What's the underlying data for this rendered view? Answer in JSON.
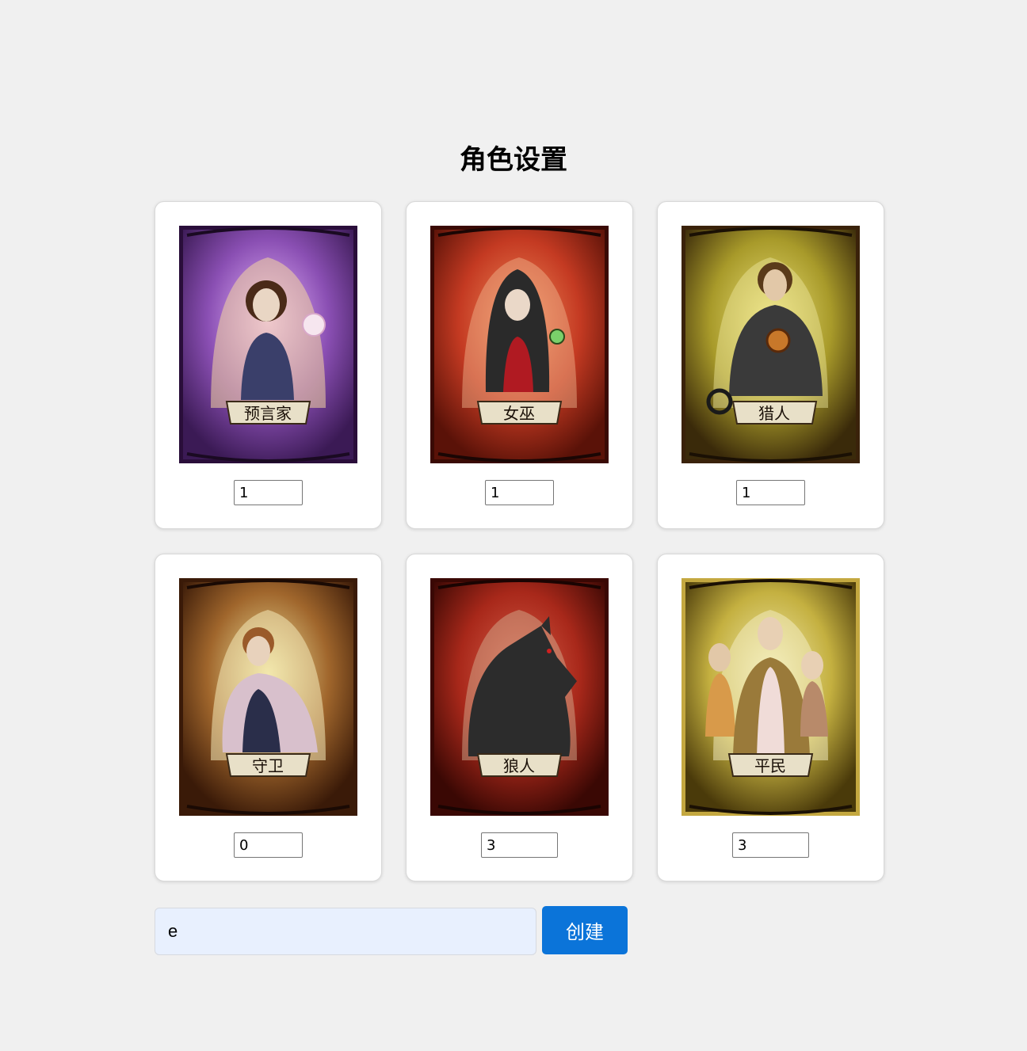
{
  "page": {
    "title": "角色设置"
  },
  "roles": [
    {
      "name": "预言家",
      "count": "1",
      "theme": "#8a4fb3",
      "accent": "#c9a2e0",
      "icon": "seer-portrait"
    },
    {
      "name": "女巫",
      "count": "1",
      "theme": "#c43a22",
      "accent": "#e8734a",
      "icon": "witch-portrait"
    },
    {
      "name": "猎人",
      "count": "1",
      "theme": "#a89a2a",
      "accent": "#d8cc4e",
      "icon": "hunter-portrait"
    },
    {
      "name": "守卫",
      "count": "0",
      "theme": "#a0662c",
      "accent": "#d4a860",
      "icon": "guard-portrait"
    },
    {
      "name": "狼人",
      "count": "3",
      "theme": "#a8281a",
      "accent": "#d24a30",
      "icon": "werewolf-portrait"
    },
    {
      "name": "平民",
      "count": "3",
      "theme": "#c4b040",
      "accent": "#e6dc7a",
      "icon": "villager-portrait"
    }
  ],
  "form": {
    "room_value": "e",
    "create_label": "创建",
    "button_color": "#0b74d9"
  }
}
